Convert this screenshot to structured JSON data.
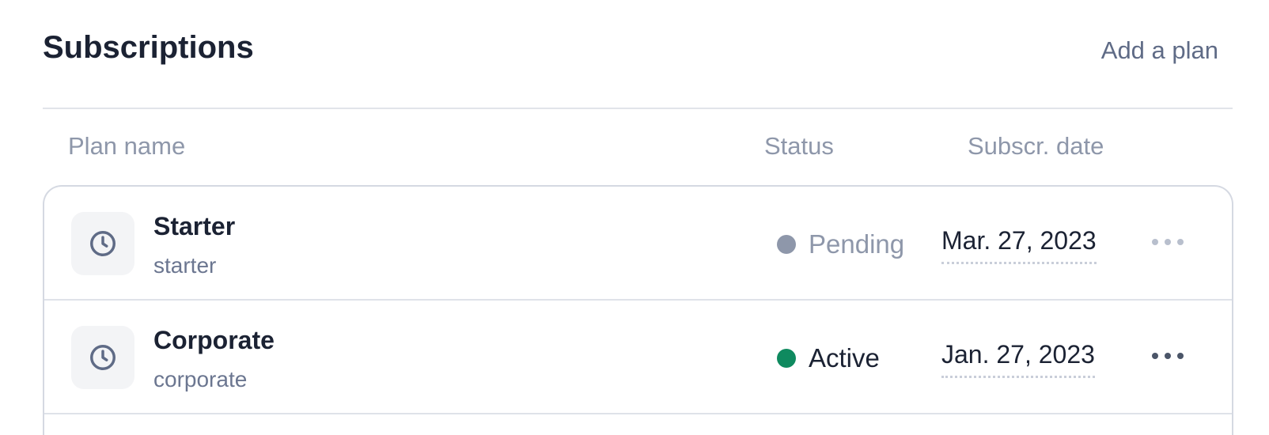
{
  "header": {
    "title": "Subscriptions",
    "add_link": "Add a plan"
  },
  "table": {
    "columns": {
      "plan": "Plan name",
      "status": "Status",
      "date": "Subscr. date"
    },
    "rows": [
      {
        "name": "Starter",
        "slug": "starter",
        "status": "Pending",
        "status_color": "#8e97aa",
        "date": "Mar. 27, 2023",
        "icon": "clock-icon"
      },
      {
        "name": "Corporate",
        "slug": "corporate",
        "status": "Active",
        "status_color": "#0f8a5f",
        "date": "Jan. 27, 2023",
        "icon": "clock-icon"
      }
    ]
  },
  "colors": {
    "title": "#1b2233",
    "muted_text": "#8e97aa",
    "link": "#5f6b86",
    "active": "#0f8a5f",
    "pending": "#8e97aa"
  }
}
